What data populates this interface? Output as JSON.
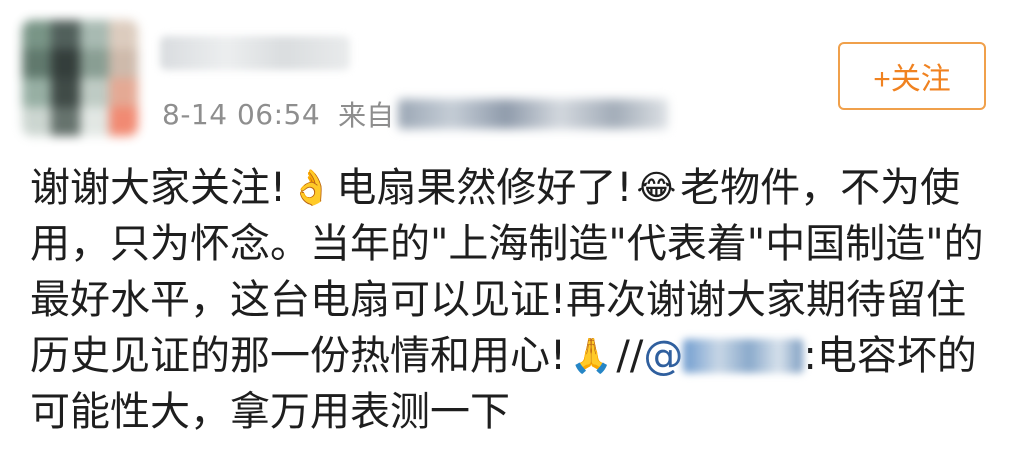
{
  "post": {
    "timestamp": "8-14 06:54",
    "source_label": "来自",
    "follow_button": "+关注",
    "lines": {
      "l1": {
        "a": "谢谢大家关注!",
        "emoji1": "👌",
        "b": "电扇果然修好了!",
        "emoji2": "😂",
        "c": "老物件，不为使"
      },
      "l2": "用，只为怀念。当年的\"上海制造\"代表着\"中国制造\"的",
      "l3": "最好水平，这台电扇可以见证!再次谢谢大家期待留住",
      "l4": {
        "a": "历史见证的那一份热情和用心!",
        "emoji": "🙏",
        "b": "//",
        "mention_prefix": "@",
        "c": ":电容坏的"
      },
      "l5": "可能性大，拿万用表测一下"
    }
  },
  "colors": {
    "accent": "#f08220",
    "follow_border": "#f0a04b",
    "meta_gray": "#8e8e8e",
    "mention_blue": "#2f5f9e"
  },
  "icons": {
    "emoji1": "ok-hand-emoji",
    "emoji2": "tears-of-joy-emoji",
    "emoji3": "praying-hands-emoji"
  }
}
